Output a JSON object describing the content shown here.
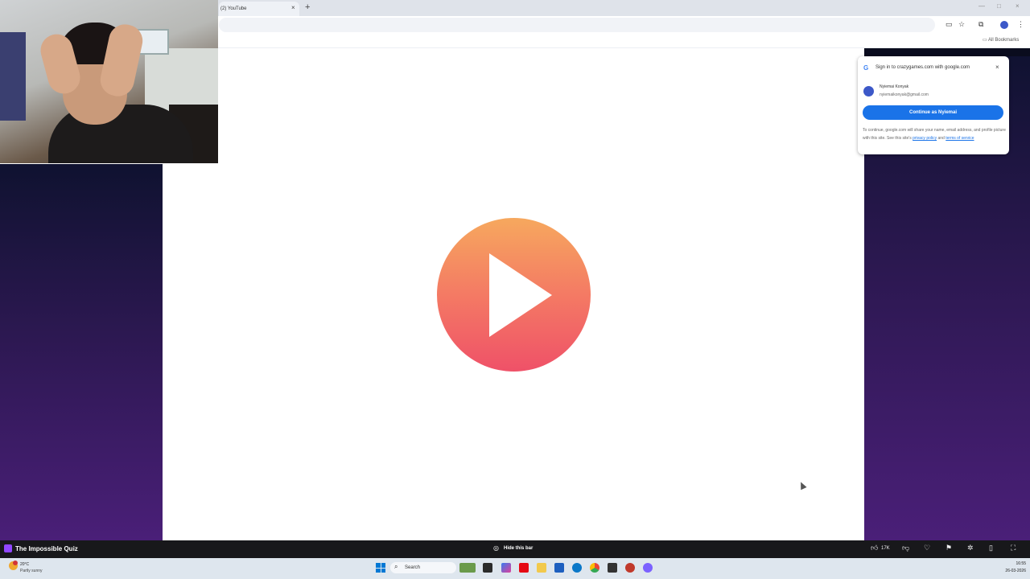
{
  "browser": {
    "tab_title": "(2) YouTube",
    "tab_close": "×",
    "new_tab": "+",
    "bookmarks_label": "All Bookmarks"
  },
  "game": {
    "play_icon": "play-icon"
  },
  "google_signin": {
    "title": "Sign in to crazygames.com with google.com",
    "close": "×",
    "account_name": "Nyiemai Konyak",
    "account_email": "nyiemaikonyak@gmail.com",
    "continue_label": "Continue as Nyiemai",
    "fine_print": "To continue, google.com will share your name, email address, and profile picture with this site. See this site's",
    "privacy_link": "privacy policy",
    "fine_and": "and",
    "terms_link": "terms of service"
  },
  "stream_bar": {
    "game_title": "The Impossible Quiz",
    "hide_label": "Hide this bar",
    "likes": "17K"
  },
  "taskbar": {
    "temperature": "20°C",
    "condition": "Partly sunny",
    "search_label": "Search",
    "time": "16:55",
    "date": "26-03-2026"
  },
  "colors": {
    "play_top": "#f6a85e",
    "play_bottom": "#ef5168",
    "signin_button": "#1a73e8",
    "stream_bar_bg": "#18181b",
    "taskbar_bg": "#dee6ee"
  }
}
